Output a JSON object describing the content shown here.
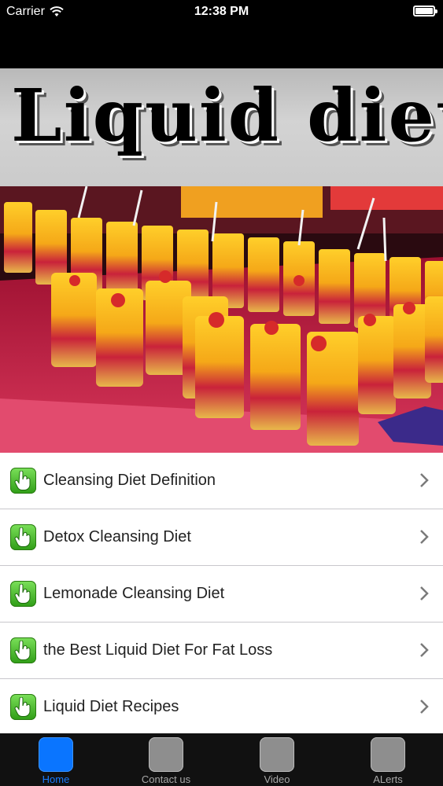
{
  "status_bar": {
    "carrier": "Carrier",
    "time": "12:38 PM",
    "battery_level": 1.0
  },
  "banner": {
    "title": "Liquid diet"
  },
  "hero_image": {
    "description_icon": "fruit-cups-photo"
  },
  "menu": {
    "items": [
      {
        "label": "Cleansing Diet Definition",
        "icon": "pointer-hand-icon"
      },
      {
        "label": "Detox Cleansing Diet",
        "icon": "pointer-hand-icon"
      },
      {
        "label": "Lemonade Cleansing Diet",
        "icon": "pointer-hand-icon"
      },
      {
        "label": "the Best Liquid Diet For Fat Loss",
        "icon": "pointer-hand-icon"
      },
      {
        "label": "Liquid Diet Recipes",
        "icon": "pointer-hand-icon"
      }
    ]
  },
  "tab_bar": {
    "tabs": [
      {
        "label": "Home",
        "active": true
      },
      {
        "label": "Contact us",
        "active": false
      },
      {
        "label": "Video",
        "active": false
      },
      {
        "label": "ALerts",
        "active": false
      }
    ]
  },
  "colors": {
    "accent": "#0a75ff",
    "list_icon_green": "#3fae22",
    "tab_inactive": "#8e8e8e"
  }
}
